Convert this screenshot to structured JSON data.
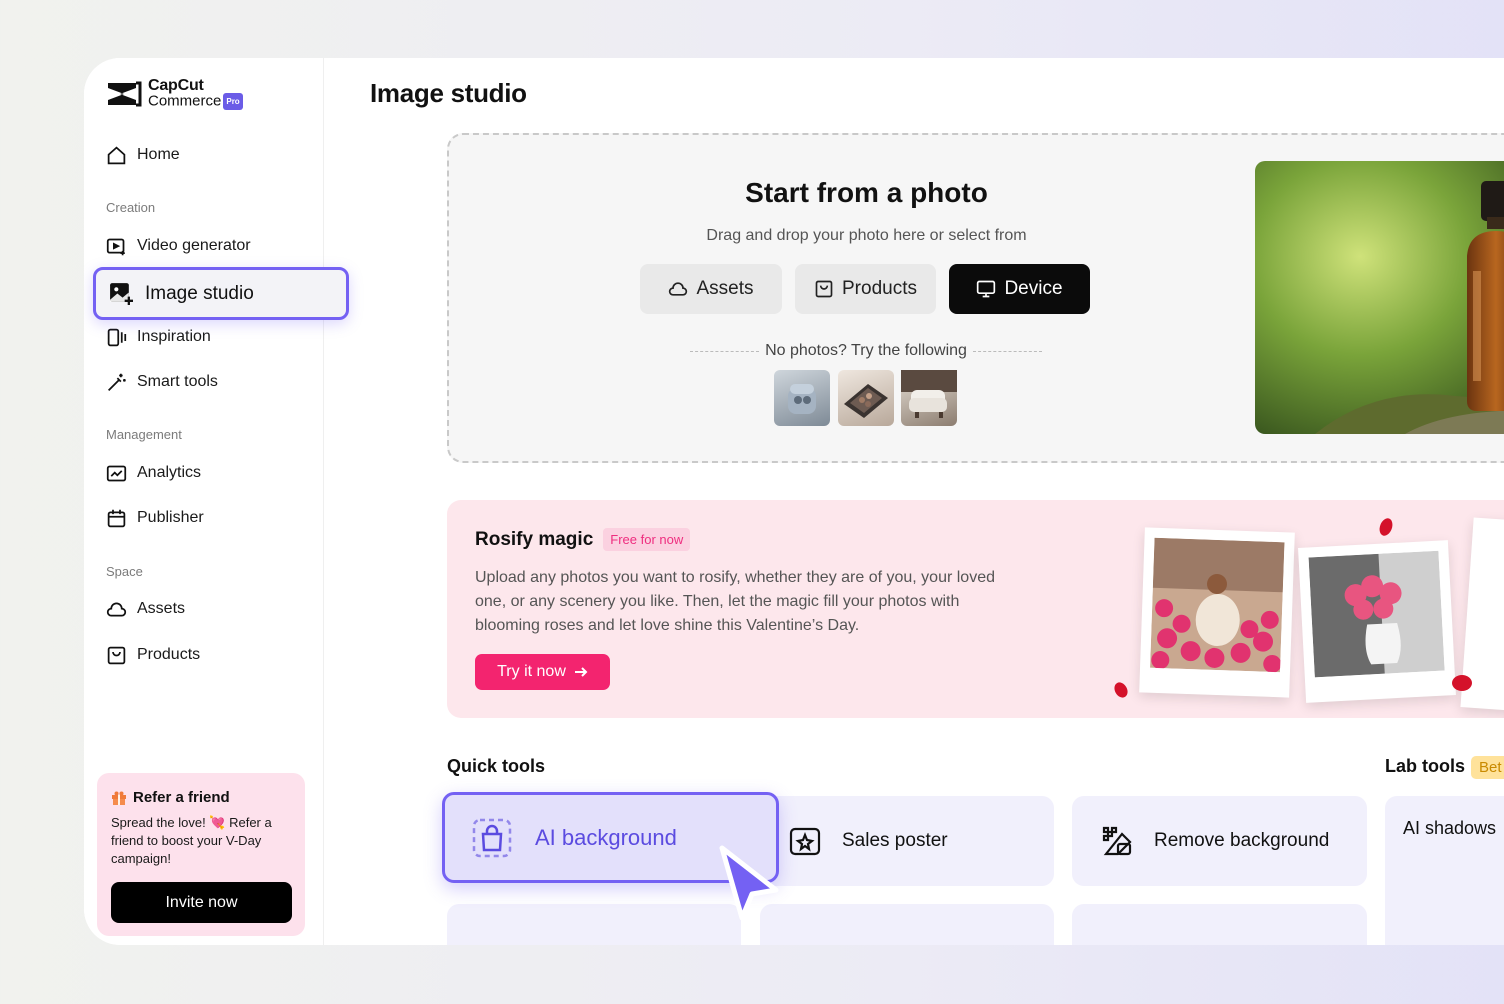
{
  "logo": {
    "line1": "CapCut",
    "line2": "Commerce",
    "badge": "Pro"
  },
  "sidebar": {
    "home": "Home",
    "section_creation": "Creation",
    "video_generator": "Video generator",
    "image_studio": "Image studio",
    "inspiration": "Inspiration",
    "smart_tools": "Smart tools",
    "section_management": "Management",
    "analytics": "Analytics",
    "publisher": "Publisher",
    "section_space": "Space",
    "assets": "Assets",
    "products": "Products"
  },
  "refer": {
    "title": "Refer a friend",
    "body": "Spread the love! 💘 Refer a friend to boost your V-Day campaign!",
    "button": "Invite now"
  },
  "page": {
    "title": "Image studio"
  },
  "upload": {
    "title": "Start from a photo",
    "subtitle": "Drag and drop your photo here or select from",
    "btn_assets": "Assets",
    "btn_products": "Products",
    "btn_device": "Device",
    "try_text": "No photos? Try the following"
  },
  "rosify": {
    "title": "Rosify magic",
    "badge": "Free for now",
    "body": "Upload any photos you want to rosify, whether they are of you, your loved one, or any scenery you like. Then, let the magic fill your photos with blooming roses and let love shine this Valentine’s Day.",
    "button": "Try it now"
  },
  "quick_tools": {
    "heading": "Quick tools",
    "items": [
      "AI background",
      "Sales poster",
      "Remove background"
    ]
  },
  "lab_tools": {
    "heading": "Lab tools",
    "badge": "Bet",
    "first": "AI shadows"
  },
  "colors": {
    "accent": "#7461f3",
    "pink": "#f3246f",
    "dark": "#0b0b0b"
  }
}
